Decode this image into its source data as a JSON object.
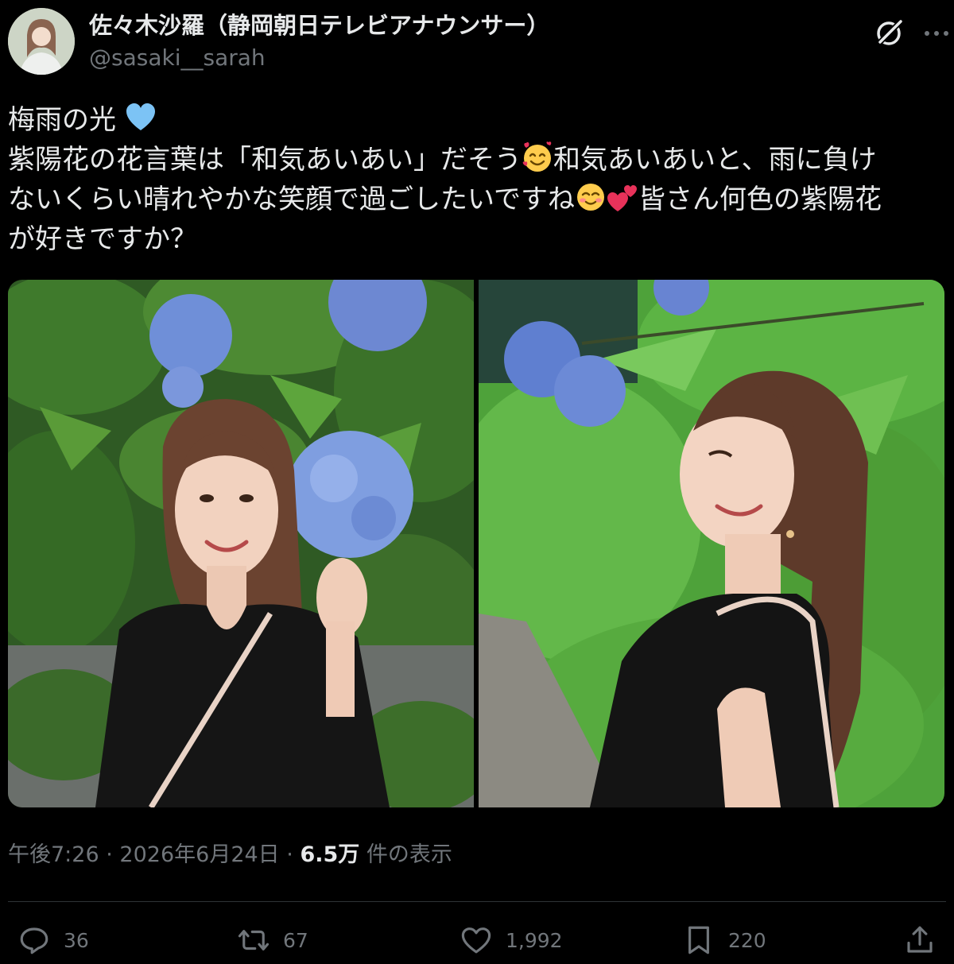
{
  "author": {
    "display_name": "佐々木沙羅（静岡朝日テレビアナウンサー）",
    "handle": "@sasaki__sarah"
  },
  "tweet": {
    "lines": [
      {
        "text": "梅雨の光",
        "emoji_after": "blue-heart"
      },
      {
        "text_a": "紫陽花の花言葉は「和気あいあい」だそう",
        "emoji": "smiling-face-with-hearts",
        "text_b": "和気あいあいと、雨に負け"
      },
      {
        "text_a": "ないくらい晴れやかな笑顔で過ごしたいですね",
        "emojis": [
          "smiling-face-with-smiling-eyes",
          "two-hearts"
        ],
        "text_b": "皆さん何色の紫陽花"
      },
      {
        "text": "が好きですか？"
      }
    ]
  },
  "meta": {
    "time": "午後7:26",
    "separator": "·",
    "date": "2026年6月24日",
    "views_count": "6.5万",
    "views_label": "件の表示"
  },
  "actions": {
    "replies": "36",
    "reposts": "67",
    "likes": "1,992",
    "bookmarks": "220"
  },
  "icons": {
    "grok": "grok-icon",
    "more": "more-icon",
    "reply": "reply-icon",
    "repost": "repost-icon",
    "like": "heart-icon",
    "bookmark": "bookmark-icon",
    "share": "share-icon"
  },
  "colors": {
    "background": "#000000",
    "text_primary": "#e7e9ea",
    "text_secondary": "#71767b",
    "divider": "#2f3336",
    "blue_heart": "#7cc3f5",
    "pink_heart": "#e8325a"
  }
}
